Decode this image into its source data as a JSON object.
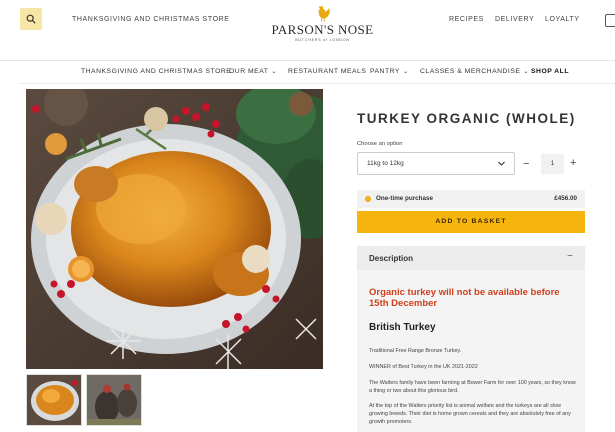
{
  "header": {
    "top_left_link": "THANKSGIVING AND CHRISTMAS STORE",
    "logo_name": "PARSON'S NOSE",
    "logo_sub": "BUTCHERS of LONDON",
    "right_links": [
      "RECIPES",
      "DELIVERY",
      "LOYALTY"
    ],
    "icons": {
      "search": "search-icon",
      "cart": "bag-icon",
      "logo": "rooster-icon"
    }
  },
  "nav": {
    "items": [
      {
        "label": "THANKSGIVING AND CHRISTMAS STORE",
        "chevron": false
      },
      {
        "label": "OUR MEAT",
        "chevron": true
      },
      {
        "label": "RESTAURANT MEALS",
        "chevron": false
      },
      {
        "label": "PANTRY",
        "chevron": true
      },
      {
        "label": "CLASSES & MERCHANDISE",
        "chevron": true
      },
      {
        "label": "SHOP ALL",
        "chevron": false
      }
    ]
  },
  "product": {
    "title": "TURKEY ORGANIC (WHOLE)",
    "option_label": "Choose an option",
    "option_value": "11kg to 12kg",
    "quantity": "1",
    "qty_minus": "−",
    "qty_plus": "+",
    "purchase_label": "One-time purchase",
    "price": "£456.00",
    "add_button": "ADD TO BASKET"
  },
  "description": {
    "heading": "Description",
    "collapse_symbol": "−",
    "warning": "Organic turkey will not be available before 15th December",
    "subheading": "British Turkey",
    "paragraphs": [
      "Traditional Free Range Bronze Turkey.",
      "WINNER of Best Turkey in the UK 2021-2022",
      "The Walters family have been farming at Bower Farm for over 100 years, so they know a thing or two about this glorious bird.",
      "At the top of the Walters priority list is animal welfare and the turkeys are all slow growing breeds. Their diet is home grown cereals and they are absolutely free of any growth promoters."
    ]
  },
  "colors": {
    "accent": "#f6b50e",
    "warning": "#d0401c",
    "search_bg": "#f6e7a6"
  }
}
